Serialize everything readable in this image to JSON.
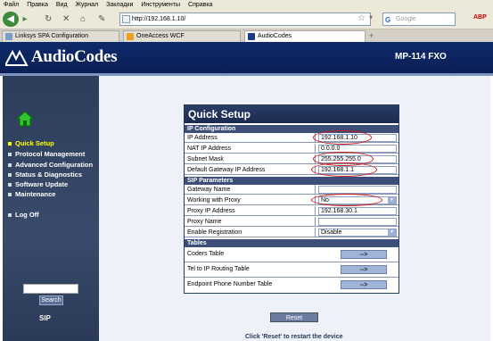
{
  "browser": {
    "menu": [
      "Файл",
      "Правка",
      "Вид",
      "Журнал",
      "Закладки",
      "Инструменты",
      "Справка"
    ],
    "address": "http://192.168.1.10/",
    "search_placeholder": "Google",
    "search_logo": "G",
    "abp": "ABP",
    "tabs": [
      {
        "label": "Linksys SPA Configuration",
        "active": false
      },
      {
        "label": "OneAccess WCF",
        "active": false
      },
      {
        "label": "AudioCodes",
        "active": true
      }
    ],
    "tab_close": "x",
    "tab_plus": "+"
  },
  "header": {
    "logo": "AudioCodes",
    "model": "MP-114 FXO"
  },
  "sidebar": {
    "items": [
      {
        "label": "Quick Setup",
        "active": true
      },
      {
        "label": "Protocol Management",
        "active": false
      },
      {
        "label": "Advanced Configuration",
        "active": false
      },
      {
        "label": "Status & Diagnostics",
        "active": false
      },
      {
        "label": "Software Update",
        "active": false
      },
      {
        "label": "Maintenance",
        "active": false
      },
      {
        "label": "Log Off",
        "active": false
      }
    ],
    "search_button": "Search",
    "footer": "SIP"
  },
  "quick_setup": {
    "title": "Quick Setup",
    "ip_section": "IP Configuration",
    "ip_rows": [
      {
        "label": "IP Address",
        "value": "192.168.1.10"
      },
      {
        "label": "NAT IP Address",
        "value": "0.0.0.0"
      },
      {
        "label": "Subnet Mask",
        "value": "255.255.255.0"
      },
      {
        "label": "Default Gateway IP Address",
        "value": "192.168.1.1"
      }
    ],
    "sip_section": "SIP Parameters",
    "sip_rows": [
      {
        "label": "Gateway Name",
        "value": ""
      },
      {
        "label": "Working with Proxy",
        "value": "No"
      },
      {
        "label": "Proxy IP Address",
        "value": "192.168.30.1"
      },
      {
        "label": "Proxy Name",
        "value": ""
      },
      {
        "label": "Enable Registration",
        "value": "Disable"
      }
    ],
    "tables_section": "Tables",
    "tables": [
      {
        "label": "Coders Table",
        "button": "-->"
      },
      {
        "label": "Tel to IP Routing Table",
        "button": "-->"
      },
      {
        "label": "Endpoint Phone Number Table",
        "button": "-->"
      }
    ],
    "reset_button": "Reset",
    "reset_note": "Click 'Reset' to restart the device"
  },
  "colors": {
    "header": "#0f2a6a",
    "sidebar": "#2d3e5c",
    "active_item": "#ffff00",
    "highlight_oval": "#d01818"
  }
}
